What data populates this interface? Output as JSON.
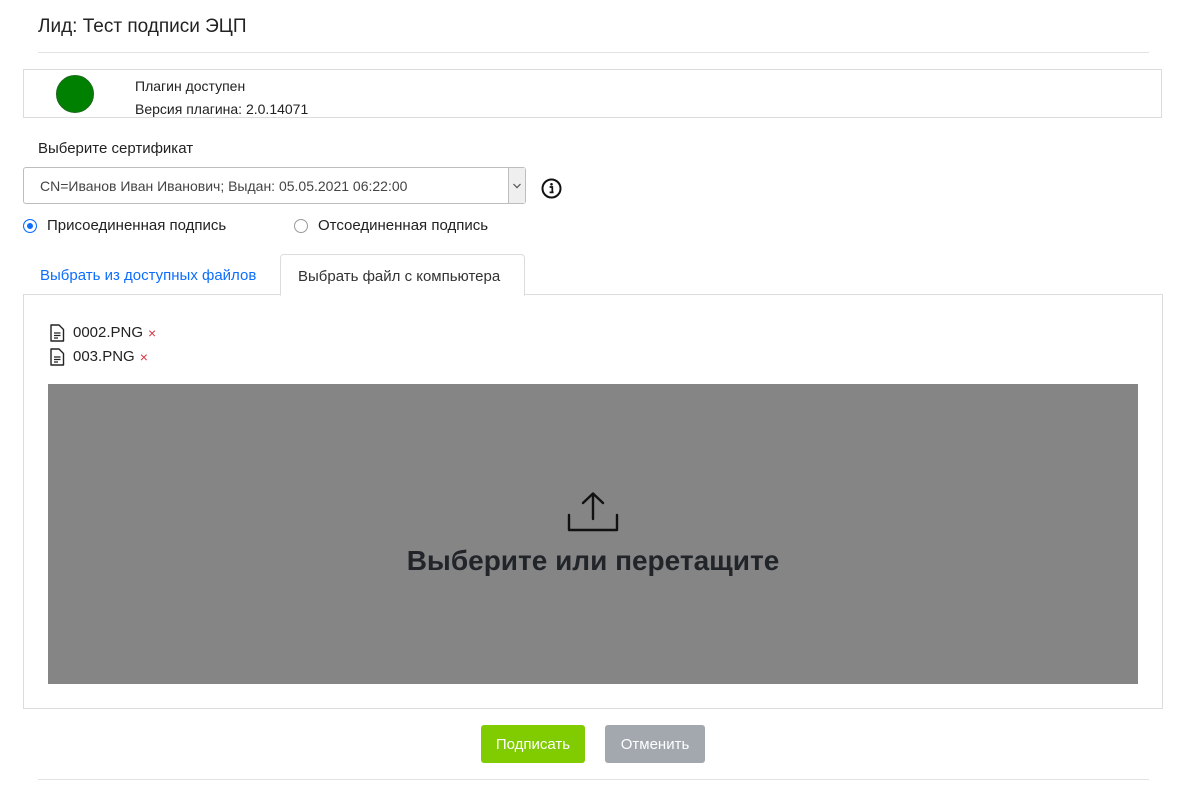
{
  "header": {
    "title": "Лид: Тест подписи ЭЦП"
  },
  "plugin": {
    "status_color": "#008000",
    "status_text": "Плагин доступен",
    "version_text": "Версия плагина: 2.0.14071"
  },
  "certificate": {
    "label": "Выберите сертификат",
    "selected": "CN=Иванов Иван Иванович; Выдан: 05.05.2021 06:22:00",
    "info_icon": "info-circle-icon"
  },
  "signature_type": {
    "options": [
      {
        "label": "Присоединенная подпись",
        "selected": true
      },
      {
        "label": "Отсоединенная подпись",
        "selected": false
      }
    ]
  },
  "tabs": [
    {
      "label": "Выбрать из доступных файлов",
      "active": false
    },
    {
      "label": "Выбрать файл с компьютера",
      "active": true
    }
  ],
  "files": [
    {
      "name": "0002.PNG",
      "remove": "×"
    },
    {
      "name": "003.PNG",
      "remove": "×"
    }
  ],
  "dropzone": {
    "text": "Выберите или перетащите",
    "icon": "upload-icon",
    "background": "#858585"
  },
  "actions": {
    "sign_label": "Подписать",
    "sign_color": "#80cc00",
    "cancel_label": "Отменить",
    "cancel_color": "#a2a8ad"
  }
}
